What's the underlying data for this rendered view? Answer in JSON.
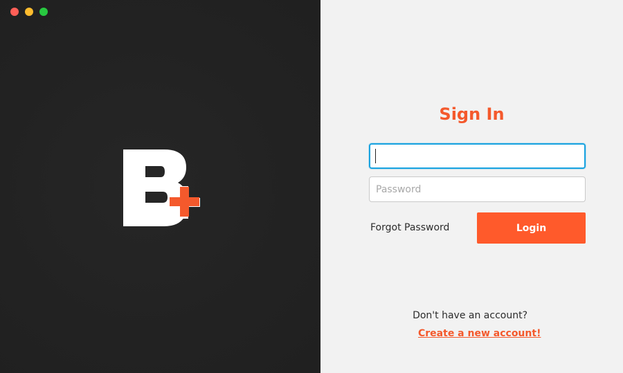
{
  "window": {
    "controls": [
      "close",
      "minimize",
      "maximize"
    ]
  },
  "brand": {
    "logo_icon": "b-plus-logo",
    "logo_colors": {
      "letter": "#ffffff",
      "plus": "#f4592c"
    }
  },
  "form": {
    "title": "Sign In",
    "username": {
      "value": "",
      "placeholder": ""
    },
    "password": {
      "value": "",
      "placeholder": "Password"
    },
    "forgot_label": "Forgot Password",
    "login_label": "Login"
  },
  "footer": {
    "prompt": "Don't have an account?",
    "create_label": "Create a new account!"
  },
  "colors": {
    "accent": "#f4592c",
    "button": "#ff5a2b",
    "focus": "#1aa3e0",
    "dark_panel": "#222222",
    "light_panel": "#f2f2f2"
  }
}
